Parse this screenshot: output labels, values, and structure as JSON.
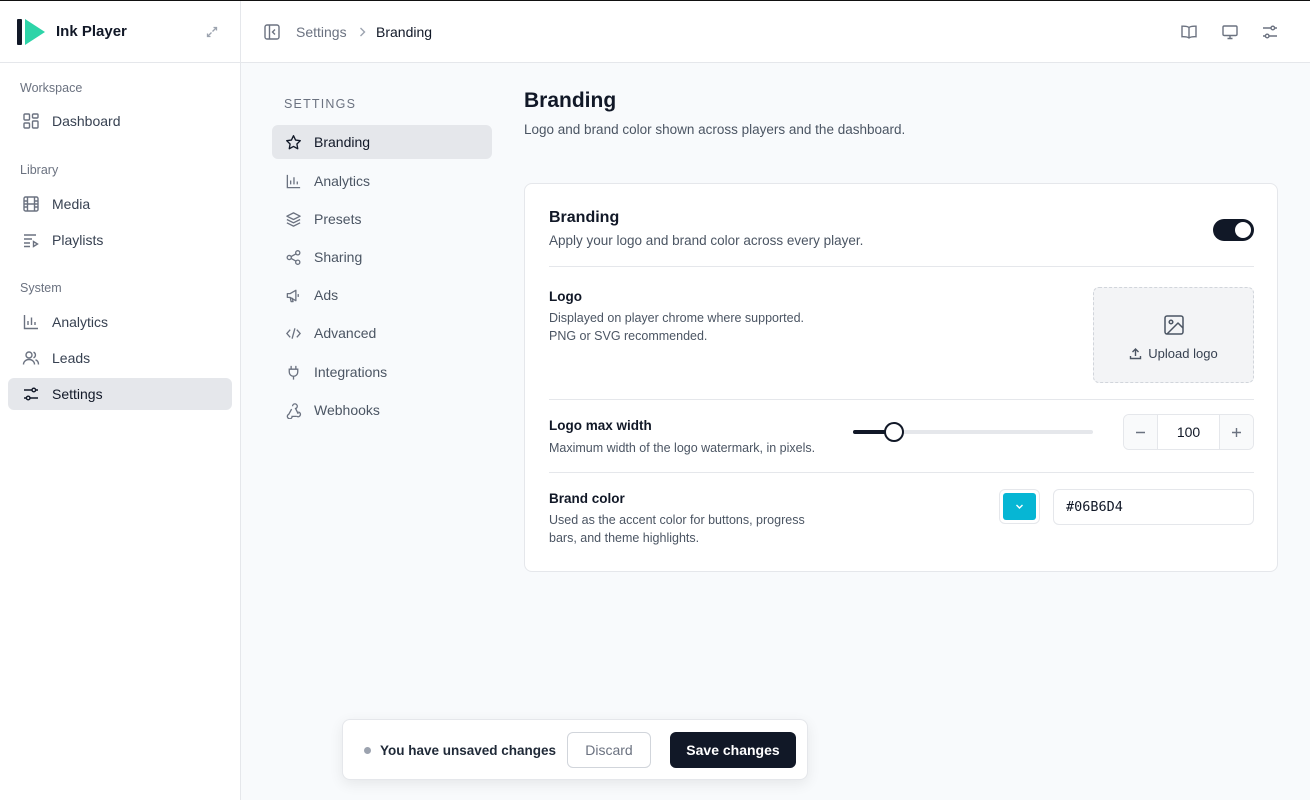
{
  "app": {
    "name": "Ink Player",
    "brand_colors": {
      "logo_dark": "#111827",
      "logo_accent": "#2dd4a8"
    }
  },
  "sidebar": {
    "sections": [
      {
        "label": "Workspace",
        "items": [
          {
            "label": "Dashboard",
            "icon": "grid-icon"
          }
        ]
      },
      {
        "label": "Library",
        "items": [
          {
            "label": "Media",
            "icon": "film-icon"
          },
          {
            "label": "Playlists",
            "icon": "playlist-icon"
          }
        ]
      },
      {
        "label": "System",
        "items": [
          {
            "label": "Analytics",
            "icon": "bar-chart-icon"
          },
          {
            "label": "Leads",
            "icon": "users-icon"
          },
          {
            "label": "Settings",
            "icon": "sliders-icon",
            "active": true
          }
        ]
      }
    ]
  },
  "breadcrumb": {
    "parent": "Settings",
    "current": "Branding"
  },
  "settings_nav": {
    "title": "SETTINGS",
    "items": [
      {
        "label": "Branding",
        "icon": "star-icon",
        "active": true
      },
      {
        "label": "Analytics",
        "icon": "bar-chart-icon"
      },
      {
        "label": "Presets",
        "icon": "layers-icon"
      },
      {
        "label": "Sharing",
        "icon": "share-icon"
      },
      {
        "label": "Ads",
        "icon": "megaphone-icon"
      },
      {
        "label": "Advanced",
        "icon": "code-icon"
      },
      {
        "label": "Integrations",
        "icon": "plug-icon"
      },
      {
        "label": "Webhooks",
        "icon": "webhook-icon"
      }
    ]
  },
  "page": {
    "title": "Branding",
    "subtitle": "Logo and brand color shown across players and the dashboard."
  },
  "card": {
    "title": "Branding",
    "subtitle": "Apply your logo and brand color across every player.",
    "enabled": true,
    "logo": {
      "label": "Logo",
      "desc_line1": "Displayed on player chrome where supported.",
      "desc_line2": "PNG or SVG recommended.",
      "upload_label": "Upload logo"
    },
    "max_width": {
      "label": "Logo max width",
      "desc": "Maximum width of the logo watermark, in pixels.",
      "value": "100",
      "slider_fraction": 0.17
    },
    "brand_color": {
      "label": "Brand color",
      "desc_line1": "Used as the accent color for buttons, progress",
      "desc_line2": "bars, and theme highlights.",
      "value": "#06B6D4",
      "swatch": "#06b6d4"
    }
  },
  "savebar": {
    "message": "You have unsaved changes",
    "discard": "Discard",
    "save": "Save changes"
  }
}
